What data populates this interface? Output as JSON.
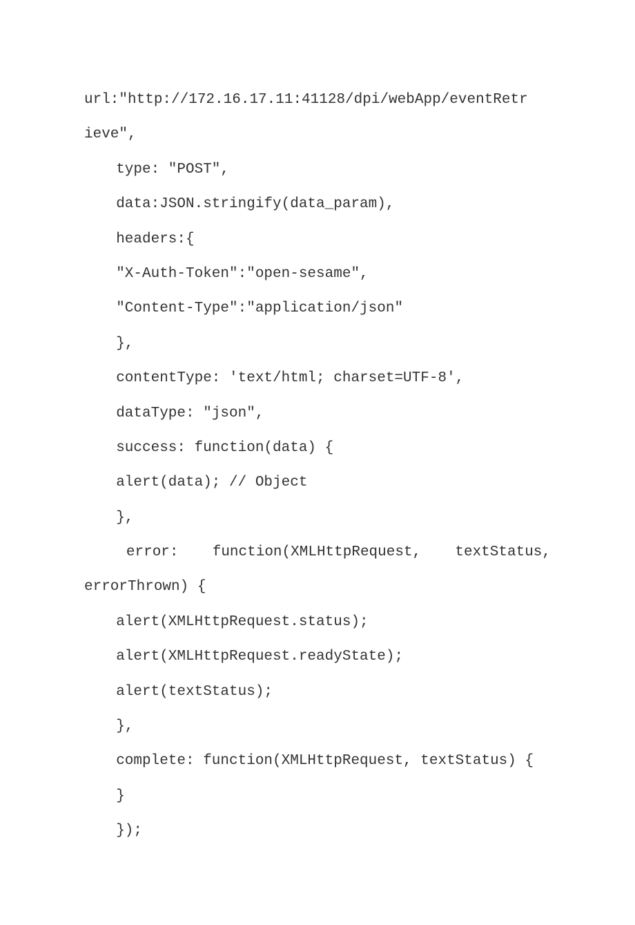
{
  "code": {
    "lines": [
      {
        "cls": "line-full",
        "text": "url:\"http://172.16.17.11:41128/dpi/webApp/eventRetr"
      },
      {
        "cls": "line",
        "text": "ieve\","
      },
      {
        "cls": "line indent",
        "text": "type: \"POST\","
      },
      {
        "cls": "line indent",
        "text": "data:JSON.stringify(data_param),"
      },
      {
        "cls": "line indent",
        "text": "headers:{"
      },
      {
        "cls": "line indent",
        "text": "\"X-Auth-Token\":\"open-sesame\","
      },
      {
        "cls": "line indent",
        "text": "\"Content-Type\":\"application/json\""
      },
      {
        "cls": "line indent",
        "text": "},"
      },
      {
        "cls": "line indent",
        "text": "contentType: 'text/html; charset=UTF-8',"
      },
      {
        "cls": "line indent",
        "text": "dataType: \"json\","
      },
      {
        "cls": "line indent",
        "text": "success: function(data) {"
      },
      {
        "cls": "line indent",
        "text": "alert(data); // Object"
      },
      {
        "cls": "line indent",
        "text": "},"
      },
      {
        "cls": "line-full indent2",
        "text": "error:  function(XMLHttpRequest,  textStatus,"
      },
      {
        "cls": "line",
        "text": "errorThrown) {"
      },
      {
        "cls": "line indent",
        "text": "alert(XMLHttpRequest.status);"
      },
      {
        "cls": "line indent",
        "text": "alert(XMLHttpRequest.readyState);"
      },
      {
        "cls": "line indent",
        "text": "alert(textStatus);"
      },
      {
        "cls": "line indent",
        "text": "},"
      },
      {
        "cls": "line indent",
        "text": "complete: function(XMLHttpRequest, textStatus) {"
      },
      {
        "cls": "line indent",
        "text": "}"
      },
      {
        "cls": "line indent",
        "text": "});"
      }
    ]
  }
}
